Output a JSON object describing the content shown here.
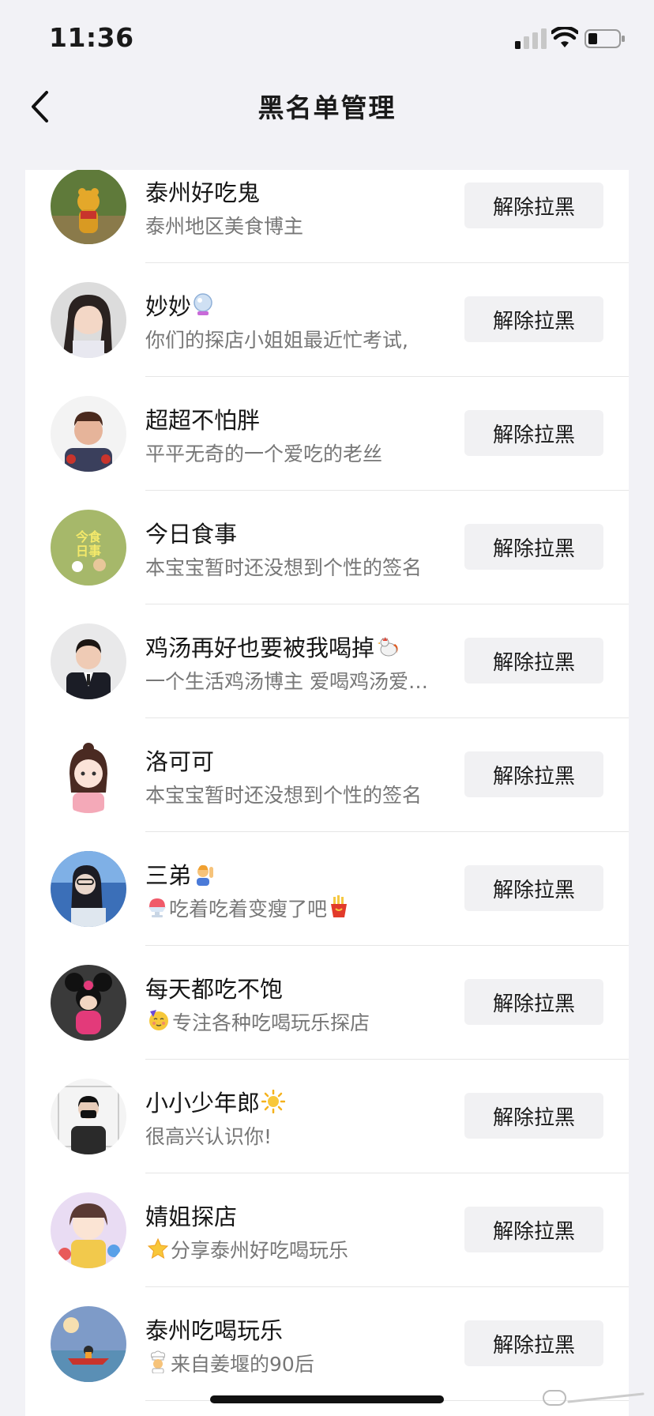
{
  "status_bar": {
    "time": "11:36"
  },
  "header": {
    "title": "黑名单管理"
  },
  "button_label": "解除拉黑",
  "users": [
    {
      "name": "泰州好吃鬼",
      "bio": "泰州地区美食博主",
      "name_emoji": "",
      "bio_emoji": "",
      "avatar": "pooh"
    },
    {
      "name": "妙妙",
      "bio": "你们的探店小姐姐最近忙考试,",
      "name_emoji": "crystal-ball",
      "bio_emoji": "",
      "avatar": "woman"
    },
    {
      "name": "超超不怕胖",
      "bio": "平平无奇的一个爱吃的老丝",
      "name_emoji": "",
      "bio_emoji": "",
      "avatar": "cartoon-man"
    },
    {
      "name": "今日食事",
      "bio": "本宝宝暂时还没想到个性的签名",
      "name_emoji": "",
      "bio_emoji": "",
      "avatar": "green-logo"
    },
    {
      "name": "鸡汤再好也要被我喝掉",
      "bio": "一个生活鸡汤博主 爱喝鸡汤爱…",
      "name_emoji": "rooster",
      "bio_emoji": "",
      "avatar": "suit-man"
    },
    {
      "name": "洛可可",
      "bio": "本宝宝暂时还没想到个性的签名",
      "name_emoji": "",
      "bio_emoji": "",
      "avatar": "anime-girl"
    },
    {
      "name": "三弟",
      "bio": "吃着吃着变瘦了吧",
      "name_emoji": "person-raising-hand",
      "bio_emoji": "shaved-ice",
      "bio_emoji_end": "fries",
      "avatar": "blue-girl"
    },
    {
      "name": "每天都吃不饱",
      "bio": "专注各种吃喝玩乐探店",
      "name_emoji": "",
      "bio_emoji": "partying-face",
      "avatar": "minnie"
    },
    {
      "name": "小小少年郎",
      "bio": "很高兴认识你!",
      "name_emoji": "sun",
      "bio_emoji": "",
      "avatar": "masked-man"
    },
    {
      "name": "婧姐探店",
      "bio": "分享泰州好吃喝玩乐",
      "name_emoji": "",
      "bio_emoji": "star",
      "avatar": "illustration"
    },
    {
      "name": "泰州吃喝玩乐",
      "bio": "来自姜堰的90后",
      "name_emoji": "",
      "bio_emoji": "chef",
      "avatar": "sky-boat"
    }
  ],
  "colors": {
    "background": "#f2f2f6",
    "card": "#ffffff",
    "button_bg": "#f1f1f3",
    "subtext": "#777777"
  }
}
